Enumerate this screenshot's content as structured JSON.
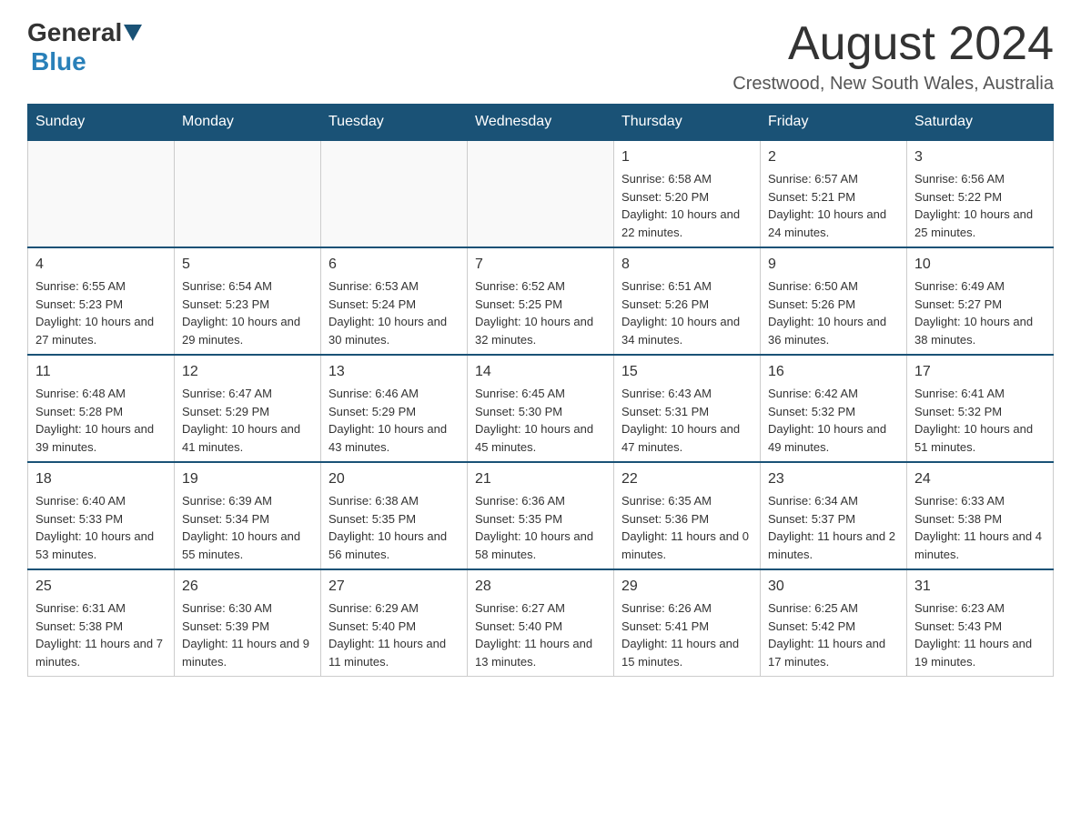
{
  "logo": {
    "text_general": "General",
    "text_blue": "Blue"
  },
  "header": {
    "month_year": "August 2024",
    "location": "Crestwood, New South Wales, Australia"
  },
  "days_of_week": [
    "Sunday",
    "Monday",
    "Tuesday",
    "Wednesday",
    "Thursday",
    "Friday",
    "Saturday"
  ],
  "weeks": [
    [
      {
        "day": "",
        "info": ""
      },
      {
        "day": "",
        "info": ""
      },
      {
        "day": "",
        "info": ""
      },
      {
        "day": "",
        "info": ""
      },
      {
        "day": "1",
        "info": "Sunrise: 6:58 AM\nSunset: 5:20 PM\nDaylight: 10 hours and 22 minutes."
      },
      {
        "day": "2",
        "info": "Sunrise: 6:57 AM\nSunset: 5:21 PM\nDaylight: 10 hours and 24 minutes."
      },
      {
        "day": "3",
        "info": "Sunrise: 6:56 AM\nSunset: 5:22 PM\nDaylight: 10 hours and 25 minutes."
      }
    ],
    [
      {
        "day": "4",
        "info": "Sunrise: 6:55 AM\nSunset: 5:23 PM\nDaylight: 10 hours and 27 minutes."
      },
      {
        "day": "5",
        "info": "Sunrise: 6:54 AM\nSunset: 5:23 PM\nDaylight: 10 hours and 29 minutes."
      },
      {
        "day": "6",
        "info": "Sunrise: 6:53 AM\nSunset: 5:24 PM\nDaylight: 10 hours and 30 minutes."
      },
      {
        "day": "7",
        "info": "Sunrise: 6:52 AM\nSunset: 5:25 PM\nDaylight: 10 hours and 32 minutes."
      },
      {
        "day": "8",
        "info": "Sunrise: 6:51 AM\nSunset: 5:26 PM\nDaylight: 10 hours and 34 minutes."
      },
      {
        "day": "9",
        "info": "Sunrise: 6:50 AM\nSunset: 5:26 PM\nDaylight: 10 hours and 36 minutes."
      },
      {
        "day": "10",
        "info": "Sunrise: 6:49 AM\nSunset: 5:27 PM\nDaylight: 10 hours and 38 minutes."
      }
    ],
    [
      {
        "day": "11",
        "info": "Sunrise: 6:48 AM\nSunset: 5:28 PM\nDaylight: 10 hours and 39 minutes."
      },
      {
        "day": "12",
        "info": "Sunrise: 6:47 AM\nSunset: 5:29 PM\nDaylight: 10 hours and 41 minutes."
      },
      {
        "day": "13",
        "info": "Sunrise: 6:46 AM\nSunset: 5:29 PM\nDaylight: 10 hours and 43 minutes."
      },
      {
        "day": "14",
        "info": "Sunrise: 6:45 AM\nSunset: 5:30 PM\nDaylight: 10 hours and 45 minutes."
      },
      {
        "day": "15",
        "info": "Sunrise: 6:43 AM\nSunset: 5:31 PM\nDaylight: 10 hours and 47 minutes."
      },
      {
        "day": "16",
        "info": "Sunrise: 6:42 AM\nSunset: 5:32 PM\nDaylight: 10 hours and 49 minutes."
      },
      {
        "day": "17",
        "info": "Sunrise: 6:41 AM\nSunset: 5:32 PM\nDaylight: 10 hours and 51 minutes."
      }
    ],
    [
      {
        "day": "18",
        "info": "Sunrise: 6:40 AM\nSunset: 5:33 PM\nDaylight: 10 hours and 53 minutes."
      },
      {
        "day": "19",
        "info": "Sunrise: 6:39 AM\nSunset: 5:34 PM\nDaylight: 10 hours and 55 minutes."
      },
      {
        "day": "20",
        "info": "Sunrise: 6:38 AM\nSunset: 5:35 PM\nDaylight: 10 hours and 56 minutes."
      },
      {
        "day": "21",
        "info": "Sunrise: 6:36 AM\nSunset: 5:35 PM\nDaylight: 10 hours and 58 minutes."
      },
      {
        "day": "22",
        "info": "Sunrise: 6:35 AM\nSunset: 5:36 PM\nDaylight: 11 hours and 0 minutes."
      },
      {
        "day": "23",
        "info": "Sunrise: 6:34 AM\nSunset: 5:37 PM\nDaylight: 11 hours and 2 minutes."
      },
      {
        "day": "24",
        "info": "Sunrise: 6:33 AM\nSunset: 5:38 PM\nDaylight: 11 hours and 4 minutes."
      }
    ],
    [
      {
        "day": "25",
        "info": "Sunrise: 6:31 AM\nSunset: 5:38 PM\nDaylight: 11 hours and 7 minutes."
      },
      {
        "day": "26",
        "info": "Sunrise: 6:30 AM\nSunset: 5:39 PM\nDaylight: 11 hours and 9 minutes."
      },
      {
        "day": "27",
        "info": "Sunrise: 6:29 AM\nSunset: 5:40 PM\nDaylight: 11 hours and 11 minutes."
      },
      {
        "day": "28",
        "info": "Sunrise: 6:27 AM\nSunset: 5:40 PM\nDaylight: 11 hours and 13 minutes."
      },
      {
        "day": "29",
        "info": "Sunrise: 6:26 AM\nSunset: 5:41 PM\nDaylight: 11 hours and 15 minutes."
      },
      {
        "day": "30",
        "info": "Sunrise: 6:25 AM\nSunset: 5:42 PM\nDaylight: 11 hours and 17 minutes."
      },
      {
        "day": "31",
        "info": "Sunrise: 6:23 AM\nSunset: 5:43 PM\nDaylight: 11 hours and 19 minutes."
      }
    ]
  ]
}
